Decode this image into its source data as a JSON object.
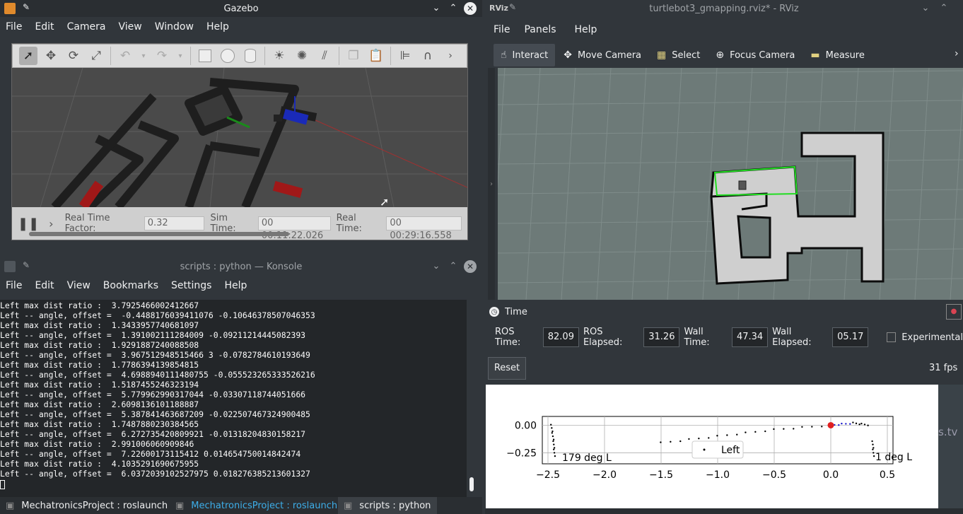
{
  "gazebo": {
    "title": "Gazebo",
    "menu": [
      "File",
      "Edit",
      "Camera",
      "View",
      "Window",
      "Help"
    ],
    "rtf_label": "Real Time Factor:",
    "rtf_value": "0.32",
    "sim_label": "Sim Time:",
    "sim_value": "00 00:11:22.026",
    "real_label": "Real Time:",
    "real_value": "00 00:29:16.558"
  },
  "konsole": {
    "title": "scripts : python — Konsole",
    "menu": [
      "File",
      "Edit",
      "View",
      "Bookmarks",
      "Settings",
      "Help"
    ],
    "lines": [
      "Left max dist ratio :  3.7925466002412667",
      "Left -- angle, offset =  -0.4488176039411076 -0.10646378507046353",
      "Left max dist ratio :  1.3433957740681097",
      "Left -- angle, offset =  1.391002111284009 -0.09211214445082393",
      "Left max dist ratio :  1.9291887240088508",
      "Left -- angle, offset =  3.967512948515466 3 -0.0782784610193649",
      "Left max dist ratio :  1.7786394139854815",
      "Left -- angle, offset =  4.6988940111480755 -0.055523265333526216",
      "Left max dist ratio :  1.5187455246323194",
      "Left -- angle, offset =  5.779962990317044 -0.03307118744051666",
      "Left max dist ratio :  2.6098136101188887",
      "Left -- angle, offset =  5.387841463687209 -0.022507467324900485",
      "Left max dist ratio :  1.7487880230384565",
      "Left -- angle, offset =  6.272735420809921 -0.01318204830158217",
      "Left max dist ratio :  2.991006060909846",
      "Left -- angle, offset =  7.22600173115412 0.014654750014842474",
      "Left max dist ratio :  4.1035291690675955",
      "Left -- angle, offset =  6.0372039102527975 0.018276385213601327"
    ],
    "tabs": [
      "MechatronicsProject : roslaunch",
      "MechatronicsProject : roslaunch",
      "scripts : python"
    ]
  },
  "rviz": {
    "title": "turtlebot3_gmapping.rviz* - RViz",
    "menu": [
      "File",
      "Panels",
      "Help"
    ],
    "tools": [
      {
        "icon": "hand-icon",
        "label": "Interact"
      },
      {
        "icon": "move-camera-icon",
        "label": "Move Camera"
      },
      {
        "icon": "select-icon",
        "label": "Select"
      },
      {
        "icon": "focus-camera-icon",
        "label": "Focus Camera"
      },
      {
        "icon": "measure-icon",
        "label": "Measure"
      }
    ],
    "time_panel": "Time",
    "ros_time_label": "ROS Time:",
    "ros_time": "82.09",
    "ros_elapsed_label": "ROS Elapsed:",
    "ros_elapsed": "31.26",
    "wall_time_label": "Wall Time:",
    "wall_time": "47.34",
    "wall_elapsed_label": "Wall Elapsed:",
    "wall_elapsed": "05.17",
    "experimental": "Experimental",
    "reset": "Reset",
    "fps": "31 fps"
  },
  "plot": {
    "legend": "Left",
    "label_left": "179 deg L",
    "label_right": "1 deg L",
    "ticks_x": [
      "−2.5",
      "−2.0",
      "−1.5",
      "−1.0",
      "−0.5",
      "0.0",
      "0.5"
    ],
    "ticks_y": [
      "0.00",
      "−0.25"
    ],
    "bg_fragment": "s.tv"
  },
  "chart_data": {
    "type": "scatter",
    "xlim": [
      -2.55,
      0.55
    ],
    "ylim": [
      -0.35,
      0.08
    ],
    "series": [
      {
        "name": "Left",
        "points": [
          [
            -2.47,
            0.0
          ],
          [
            -2.45,
            -0.15
          ],
          [
            -2.44,
            -0.3
          ],
          [
            -1.5,
            -0.16
          ],
          [
            -1.0,
            -0.1
          ],
          [
            -0.5,
            -0.04
          ],
          [
            0.0,
            0.0
          ],
          [
            0.2,
            0.02
          ],
          [
            0.35,
            0.0
          ],
          [
            0.37,
            -0.15
          ],
          [
            0.38,
            -0.3
          ]
        ]
      }
    ],
    "x_ticks": [
      -2.5,
      -2.0,
      -1.5,
      -1.0,
      -0.5,
      0.0,
      0.5
    ],
    "y_ticks": [
      0.0,
      -0.25
    ],
    "grid": true,
    "legend_position": "bottom-center"
  }
}
